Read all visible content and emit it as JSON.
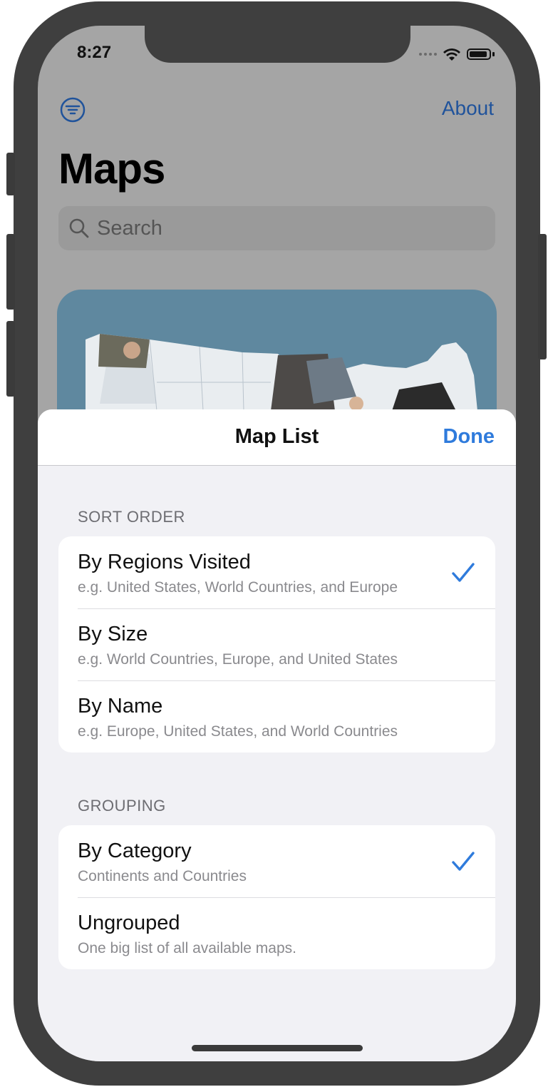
{
  "status": {
    "time": "8:27"
  },
  "nav": {
    "about_label": "About"
  },
  "page": {
    "title": "Maps"
  },
  "search": {
    "placeholder": "Search"
  },
  "sheet": {
    "title": "Map List",
    "done_label": "Done",
    "sort_order": {
      "header": "SORT ORDER",
      "options": [
        {
          "title": "By Regions Visited",
          "subtitle": "e.g. United States, World Countries, and Europe",
          "selected": true
        },
        {
          "title": "By Size",
          "subtitle": "e.g. World Countries, Europe, and United States",
          "selected": false
        },
        {
          "title": "By Name",
          "subtitle": "e.g. Europe, United States, and World Countries",
          "selected": false
        }
      ]
    },
    "grouping": {
      "header": "GROUPING",
      "options": [
        {
          "title": "By Category",
          "subtitle": "Continents and Countries",
          "selected": true
        },
        {
          "title": "Ungrouped",
          "subtitle": "One big list of all available maps.",
          "selected": false
        }
      ]
    }
  },
  "colors": {
    "accent": "#2f7bdc",
    "nav_link_dimmed": "#20539b"
  },
  "icons": {
    "filter": "filter-circle-icon",
    "search": "magnifying-glass-icon",
    "check": "checkmark-icon"
  }
}
